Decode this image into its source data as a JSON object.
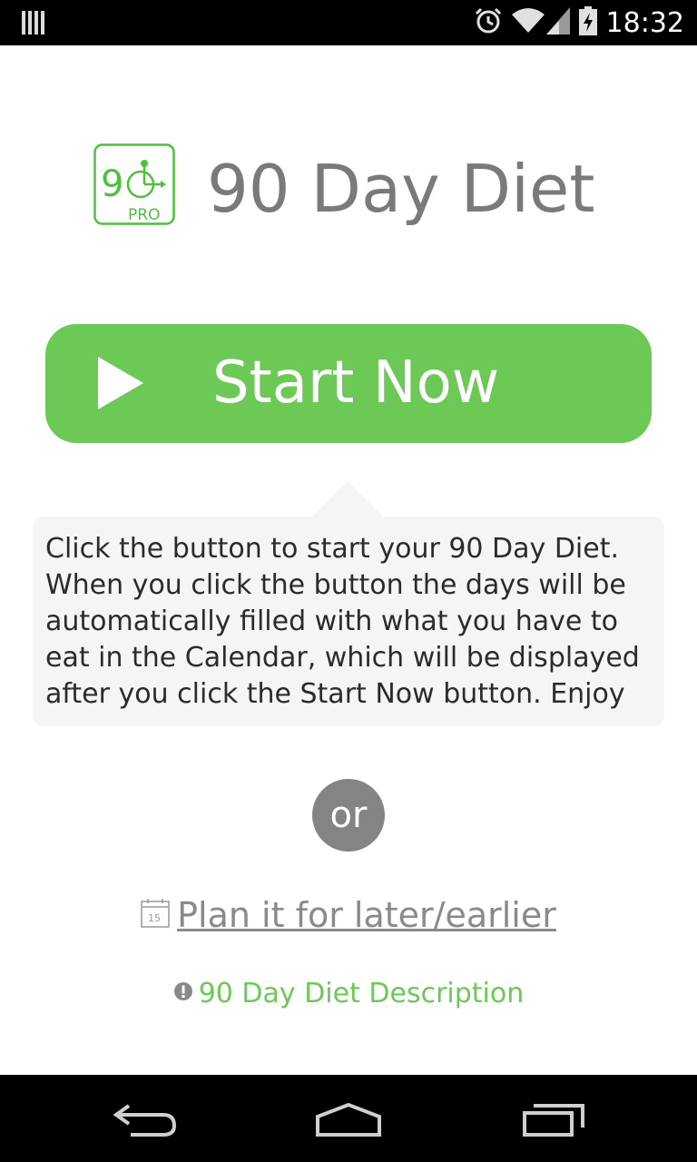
{
  "status_bar": {
    "time": "18:32",
    "icons": [
      "notification-bars-icon",
      "alarm-icon",
      "wifi-icon",
      "signal-icon",
      "battery-charging-icon"
    ]
  },
  "app": {
    "title": "90 Day Diet",
    "logo": {
      "number": "9",
      "badge": "PRO"
    }
  },
  "start_button": {
    "label": "Start Now",
    "icon": "play-icon",
    "color": "#6cc955"
  },
  "tip": {
    "text": "Click the button to start your 90 Day Diet. When you click the button the days will be automatically filled with what you have to eat in the Calendar, which will be displayed after you click the Start Now button. Enjoy"
  },
  "or_label": "or",
  "plan_link": {
    "label": "Plan it for later/earlier",
    "icon": "calendar-icon",
    "calendar_day": "15"
  },
  "description_link": {
    "label": "90 Day Diet Description",
    "icon": "info-icon",
    "color": "#6cc955"
  },
  "nav_bar": {
    "buttons": [
      "back-icon",
      "home-icon",
      "recent-apps-icon"
    ]
  }
}
